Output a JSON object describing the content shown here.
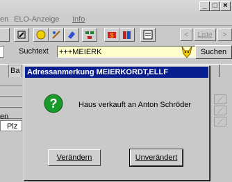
{
  "window": {
    "controls": {
      "minimize": "_",
      "maximize": "□",
      "close": "×"
    }
  },
  "menu": {
    "items": [
      {
        "label": "en"
      },
      {
        "label": "ELO-Anzeige"
      },
      {
        "label": "Info"
      }
    ]
  },
  "toolbar": {
    "nav": {
      "prev": "<",
      "list": "Liste",
      "next": ">"
    }
  },
  "search": {
    "label": "Suchtext",
    "value": "+++MEIERK",
    "button": "Suchen"
  },
  "background_form": {
    "tab_fragment": "Ba",
    "field_label_fragment": "en",
    "plz_label": "Plz"
  },
  "dialog": {
    "title": "Adressanmerkung MEIERKORDT,ELLF",
    "message": "Haus verkauft an Anton Schröder",
    "buttons": {
      "change": "Verändern",
      "keep": "Unverändert"
    }
  },
  "colors": {
    "dialog_title_bg": "#0a1f8f",
    "search_input_bg": "#ffffcc",
    "question_icon": "#1a9a2a"
  }
}
